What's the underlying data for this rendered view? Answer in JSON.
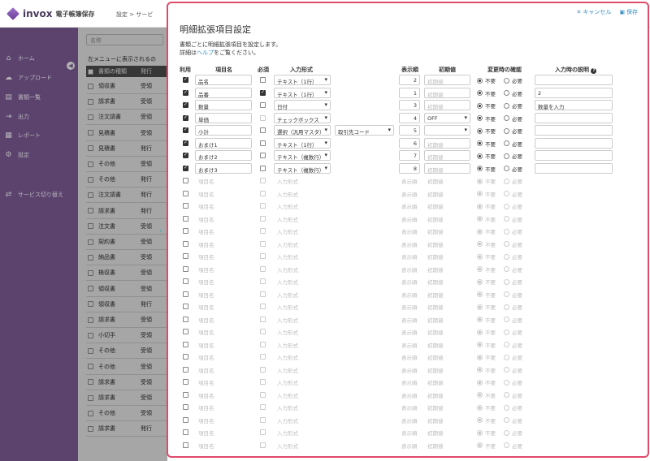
{
  "app": {
    "name": "invox",
    "subtitle": "電子帳簿保存",
    "breadcrumb": "設定 > サービ"
  },
  "sidebar": {
    "items": [
      {
        "label": "ホーム",
        "icon": "home-icon",
        "glyph": "⌂"
      },
      {
        "label": "アップロード",
        "icon": "cloud-upload-icon",
        "glyph": "☁"
      },
      {
        "label": "書類一覧",
        "icon": "document-icon",
        "glyph": "▤"
      },
      {
        "label": "出力",
        "icon": "output-icon",
        "glyph": "⇥"
      },
      {
        "label": "レポート",
        "icon": "chart-icon",
        "glyph": "▦"
      },
      {
        "label": "設定",
        "icon": "gear-icon",
        "glyph": "⚙"
      },
      {
        "label": "サービス切り替え",
        "icon": "switch-icon",
        "glyph": "⇄"
      }
    ]
  },
  "bglist": {
    "search_placeholder": "名称",
    "note": "左メニューに表示されるの",
    "header": {
      "type": "書類の種類",
      "status": "発行"
    },
    "rows": [
      {
        "type": "領収書",
        "status": "受領"
      },
      {
        "type": "請求書",
        "status": "受領"
      },
      {
        "type": "注文請書",
        "status": "受領"
      },
      {
        "type": "見積書",
        "status": "受領"
      },
      {
        "type": "見積書",
        "status": "発行"
      },
      {
        "type": "その他",
        "status": "受領"
      },
      {
        "type": "その他",
        "status": "発行"
      },
      {
        "type": "注文請書",
        "status": "発行"
      },
      {
        "type": "請求書",
        "status": "発行"
      },
      {
        "type": "注文書",
        "status": "受領"
      },
      {
        "type": "契約書",
        "status": "受領"
      },
      {
        "type": "納品書",
        "status": "受領"
      },
      {
        "type": "検収書",
        "status": "受領"
      },
      {
        "type": "領収書",
        "status": "受領"
      },
      {
        "type": "領収書",
        "status": "発行"
      },
      {
        "type": "請求書",
        "status": "受領"
      },
      {
        "type": "小切手",
        "status": "受領"
      },
      {
        "type": "その他",
        "status": "受領"
      },
      {
        "type": "その他",
        "status": "受領"
      },
      {
        "type": "請求書",
        "status": "受領"
      },
      {
        "type": "請求書",
        "status": "受領"
      },
      {
        "type": "その他",
        "status": "受領"
      },
      {
        "type": "請求書",
        "status": "発行"
      }
    ]
  },
  "modal": {
    "cancel_label": "キャンセル",
    "save_label": "保存",
    "title": "明細拡張項目設定",
    "desc1": "書類ごとに明細拡張項目を設定します。",
    "desc2_prefix": "詳細は",
    "desc2_link": "ヘルプ",
    "desc2_suffix": "をご覧ください。",
    "columns": {
      "use": "利用",
      "name": "項目名",
      "required": "必須",
      "input_type": "入力形式",
      "order": "表示順",
      "initial": "初期値",
      "confirm": "変更時の確認",
      "description": "入力時の説明"
    },
    "radio_labels": {
      "no": "不要",
      "yes": "必要"
    },
    "placeholders": {
      "name": "項目名",
      "input_type": "入力形式",
      "order": "表示順",
      "initial": "初期値"
    },
    "active_rows": [
      {
        "name": "品名",
        "required": false,
        "required_enabled": true,
        "type": "テキスト（1行）",
        "master": "",
        "order": "2",
        "initial": "",
        "initial_select": false,
        "description": ""
      },
      {
        "name": "品番",
        "required": true,
        "required_enabled": true,
        "type": "テキスト（1行）",
        "master": "",
        "order": "1",
        "initial": "",
        "initial_select": false,
        "description": "2"
      },
      {
        "name": "数量",
        "required": false,
        "required_enabled": true,
        "type": "日付",
        "master": "",
        "order": "3",
        "initial": "",
        "initial_select": false,
        "description": "数量を入力"
      },
      {
        "name": "単価",
        "required": false,
        "required_enabled": false,
        "type": "チェックボックス",
        "master": "",
        "order": "4",
        "initial": "OFF",
        "initial_select": true,
        "description": ""
      },
      {
        "name": "小計",
        "required": false,
        "required_enabled": true,
        "type": "選択（汎用マスタ）",
        "master": "取引先コード",
        "order": "5",
        "initial": "",
        "initial_select": true,
        "description": ""
      },
      {
        "name": "おまけ1",
        "required": false,
        "required_enabled": true,
        "type": "テキスト（1行）",
        "master": "",
        "order": "6",
        "initial": "",
        "initial_select": false,
        "description": ""
      },
      {
        "name": "おまけ2",
        "required": false,
        "required_enabled": true,
        "type": "テキスト（複数行）",
        "master": "",
        "order": "7",
        "initial": "",
        "initial_select": false,
        "description": ""
      },
      {
        "name": "おまけ3",
        "required": false,
        "required_enabled": true,
        "type": "テキスト（複数行）",
        "master": "",
        "order": "8",
        "initial": "",
        "initial_select": false,
        "description": ""
      }
    ],
    "inactive_row_count": 22
  }
}
